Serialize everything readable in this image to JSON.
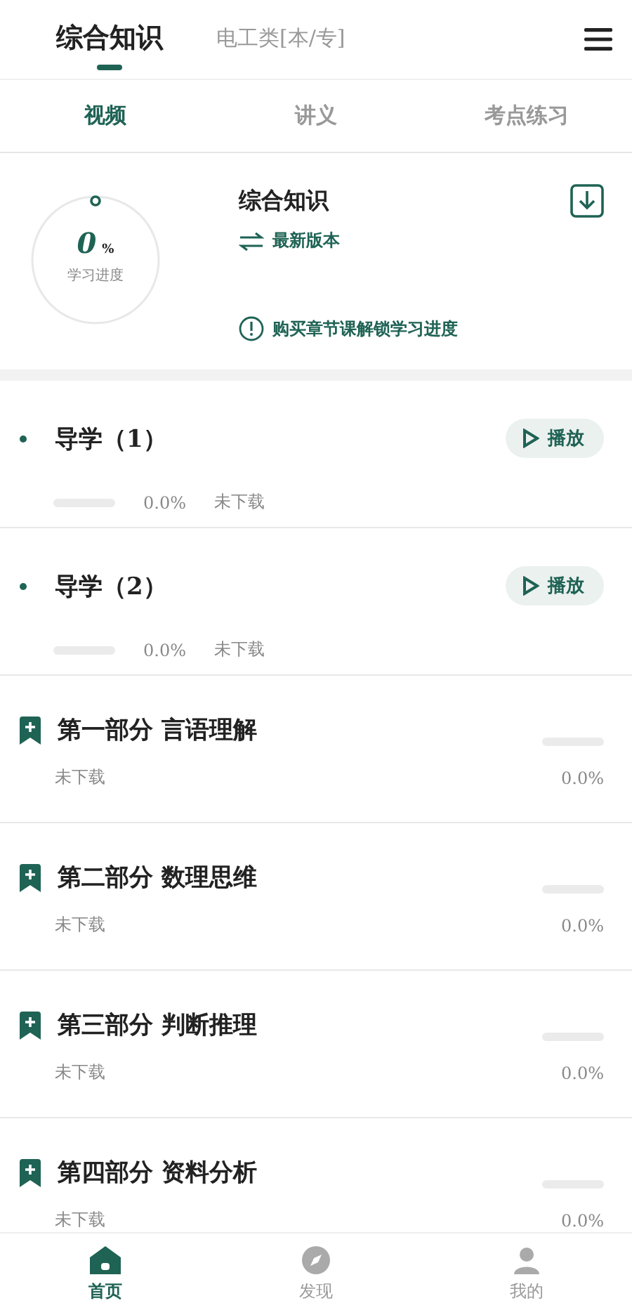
{
  "header": {
    "tabs": [
      {
        "label": "综合知识",
        "selected": true
      },
      {
        "label": "电工类[本/专]",
        "selected": false
      }
    ]
  },
  "sub_tabs": [
    {
      "label": "视频",
      "selected": true
    },
    {
      "label": "讲义",
      "selected": false
    },
    {
      "label": "考点练习",
      "selected": false
    }
  ],
  "progress_card": {
    "percent": "0",
    "unit": "%",
    "caption": "学习进度",
    "title": "综合知识",
    "version": "最新版本",
    "notice": "购买章节课解锁学习进度"
  },
  "items": [
    {
      "kind": "lesson",
      "title": "导学（1）",
      "button": "播放",
      "level": 0,
      "percent": "0.0%",
      "status": "未下载"
    },
    {
      "kind": "lesson",
      "title": "导学（2）",
      "button": "播放",
      "level": 0,
      "percent": "0.0%",
      "status": "未下载"
    },
    {
      "kind": "chapter",
      "title": "第一部分 言语理解",
      "level": 0,
      "percent": "0.0%",
      "status": "未下载"
    },
    {
      "kind": "chapter",
      "title": "第二部分 数理思维",
      "level": 0,
      "percent": "0.0%",
      "status": "未下载"
    },
    {
      "kind": "chapter",
      "title": "第三部分 判断推理",
      "level": 0,
      "percent": "0.0%",
      "status": "未下载"
    },
    {
      "kind": "chapter",
      "title": "第四部分  资料分析",
      "level": 0,
      "percent": "0.0%",
      "status": "未下载"
    }
  ],
  "bottom_nav": [
    {
      "label": "首页",
      "selected": true
    },
    {
      "label": "发现",
      "selected": false
    },
    {
      "label": "我的",
      "selected": false
    }
  ]
}
